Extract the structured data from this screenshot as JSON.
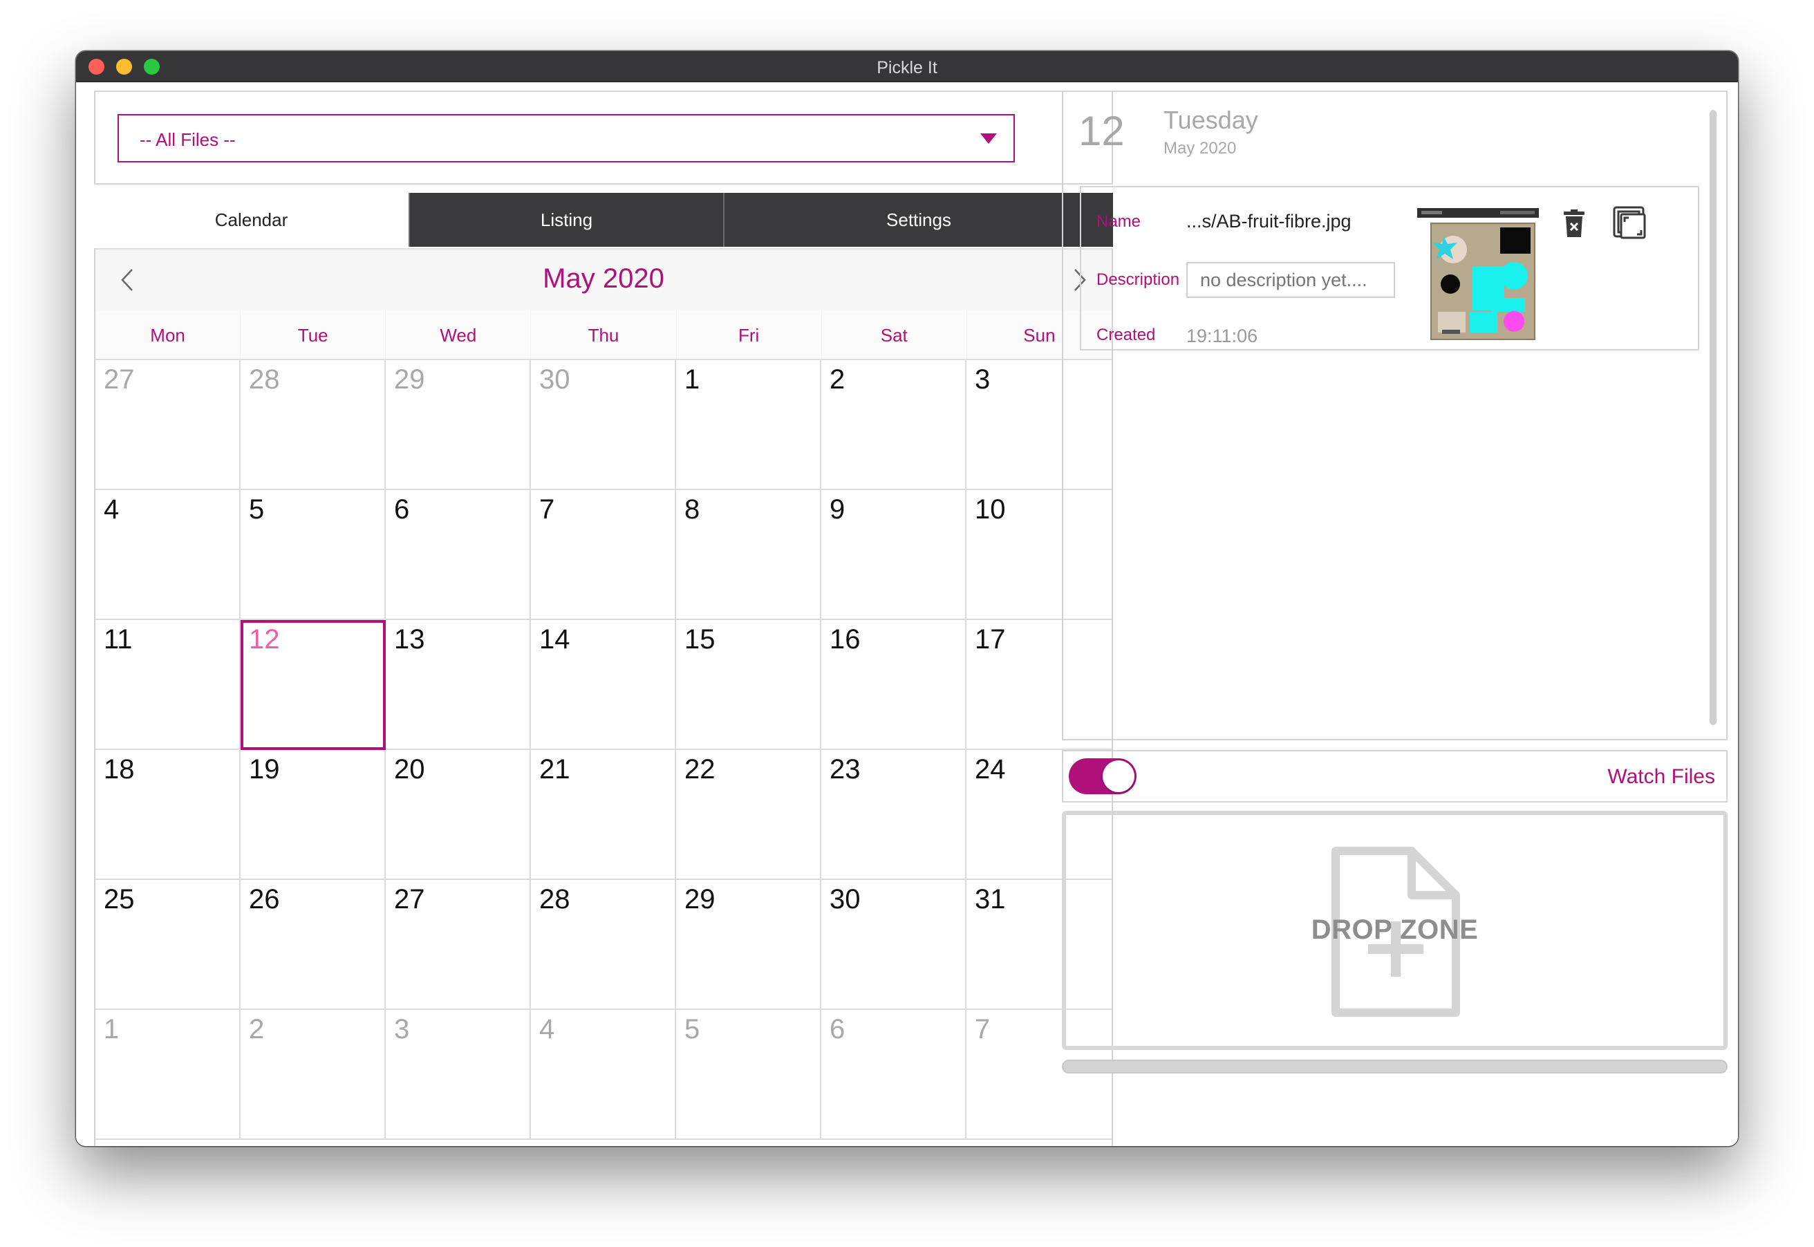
{
  "window": {
    "title": "Pickle It"
  },
  "filter": {
    "selected": "-- All Files --"
  },
  "tabs": [
    {
      "label": "Calendar",
      "active": true
    },
    {
      "label": "Listing",
      "active": false
    },
    {
      "label": "Settings",
      "active": false
    }
  ],
  "calendar": {
    "month_title": "May 2020",
    "weekdays": [
      "Mon",
      "Tue",
      "Wed",
      "Thu",
      "Fri",
      "Sat",
      "Sun"
    ],
    "days": [
      {
        "n": "27",
        "other": true
      },
      {
        "n": "28",
        "other": true
      },
      {
        "n": "29",
        "other": true
      },
      {
        "n": "30",
        "other": true
      },
      {
        "n": "1"
      },
      {
        "n": "2"
      },
      {
        "n": "3"
      },
      {
        "n": "4"
      },
      {
        "n": "5"
      },
      {
        "n": "6"
      },
      {
        "n": "7"
      },
      {
        "n": "8"
      },
      {
        "n": "9"
      },
      {
        "n": "10"
      },
      {
        "n": "11"
      },
      {
        "n": "12",
        "selected": true
      },
      {
        "n": "13"
      },
      {
        "n": "14"
      },
      {
        "n": "15"
      },
      {
        "n": "16"
      },
      {
        "n": "17"
      },
      {
        "n": "18"
      },
      {
        "n": "19"
      },
      {
        "n": "20"
      },
      {
        "n": "21"
      },
      {
        "n": "22"
      },
      {
        "n": "23"
      },
      {
        "n": "24"
      },
      {
        "n": "25"
      },
      {
        "n": "26"
      },
      {
        "n": "27"
      },
      {
        "n": "28"
      },
      {
        "n": "29"
      },
      {
        "n": "30"
      },
      {
        "n": "31"
      },
      {
        "n": "1",
        "other": true
      },
      {
        "n": "2",
        "other": true
      },
      {
        "n": "3",
        "other": true
      },
      {
        "n": "4",
        "other": true
      },
      {
        "n": "5",
        "other": true
      },
      {
        "n": "6",
        "other": true
      },
      {
        "n": "7",
        "other": true
      }
    ]
  },
  "detail": {
    "day": "12",
    "weekday": "Tuesday",
    "month_year": "May 2020",
    "file": {
      "name_label": "Name",
      "name": "...s/AB-fruit-fibre.jpg",
      "description_label": "Description",
      "description_placeholder": "no description yet....",
      "created_label": "Created",
      "created": "19:11:06"
    }
  },
  "watch": {
    "label": "Watch Files",
    "enabled": true
  },
  "drop_zone": {
    "label": "DROP ZONE"
  },
  "upload_progress": 0,
  "colors": {
    "accent": "#b0107a",
    "selected_day": "#ec5fa8",
    "tab_dark": "#3a3a3c"
  },
  "icons": {
    "prev": "chevron-left-icon",
    "next": "chevron-right-icon",
    "dropdown": "caret-down-icon",
    "delete": "trash-icon",
    "expand": "expand-icon",
    "drop": "file-plus-icon"
  }
}
